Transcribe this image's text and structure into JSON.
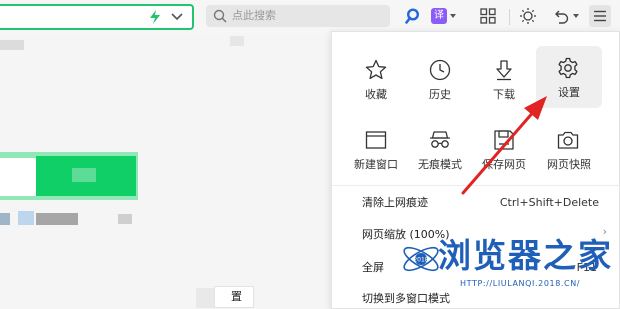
{
  "toolbar": {
    "search_placeholder": "点此搜索",
    "translate_label": "译"
  },
  "menu": {
    "tiles": [
      {
        "label": "收藏",
        "icon": "star-icon"
      },
      {
        "label": "历史",
        "icon": "clock-icon"
      },
      {
        "label": "下载",
        "icon": "download-icon"
      },
      {
        "label": "设置",
        "icon": "gear-icon"
      },
      {
        "label": "新建窗口",
        "icon": "window-icon"
      },
      {
        "label": "无痕模式",
        "icon": "incognito-icon"
      },
      {
        "label": "保存网页",
        "icon": "save-icon"
      },
      {
        "label": "网页快照",
        "icon": "camera-icon"
      }
    ],
    "rows": [
      {
        "label": "清除上网痕迹",
        "shortcut": "Ctrl+Shift+Delete"
      },
      {
        "label": "网页缩放 (100%)",
        "arrow": "›"
      },
      {
        "label": "全屏",
        "shortcut": "F11"
      },
      {
        "label": "切换到多窗口模式"
      }
    ]
  },
  "page": {
    "fragment_text": "置"
  },
  "watermark": {
    "title": "浏览器之家",
    "url": "HTTP://LIULANQI.2018.CN/",
    "year": "2018"
  },
  "colors": {
    "accent_green": "#0fcf66",
    "arrow_red": "#e02424",
    "watermark_blue": "#1f5fb8"
  }
}
